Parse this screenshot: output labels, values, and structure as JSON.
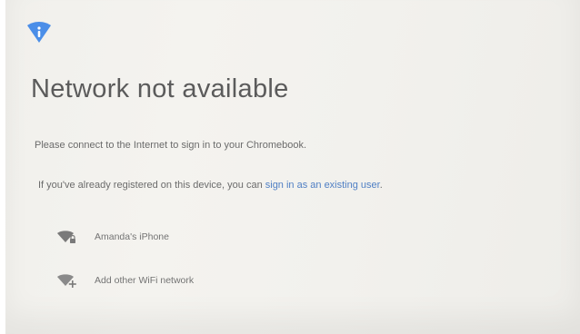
{
  "app": {
    "title": "Network not available"
  },
  "messages": {
    "connect_prompt": "Please connect to the Internet to sign in to your Chromebook.",
    "registered_prefix": "If you've already registered on this device, you can ",
    "existing_user_link": "sign in as an existing user",
    "registered_suffix": "."
  },
  "networks": [
    {
      "label": "Amanda's iPhone",
      "icon": "wifi-locked-icon"
    },
    {
      "label": "Add other WiFi network",
      "icon": "wifi-add-icon"
    }
  ],
  "colors": {
    "accent": "#4f7fc4",
    "shield": "#4b8ee8",
    "title_text": "#5b5b5b",
    "body_text": "#6b6b6b"
  },
  "icons": {
    "header": "shield-info-icon"
  }
}
